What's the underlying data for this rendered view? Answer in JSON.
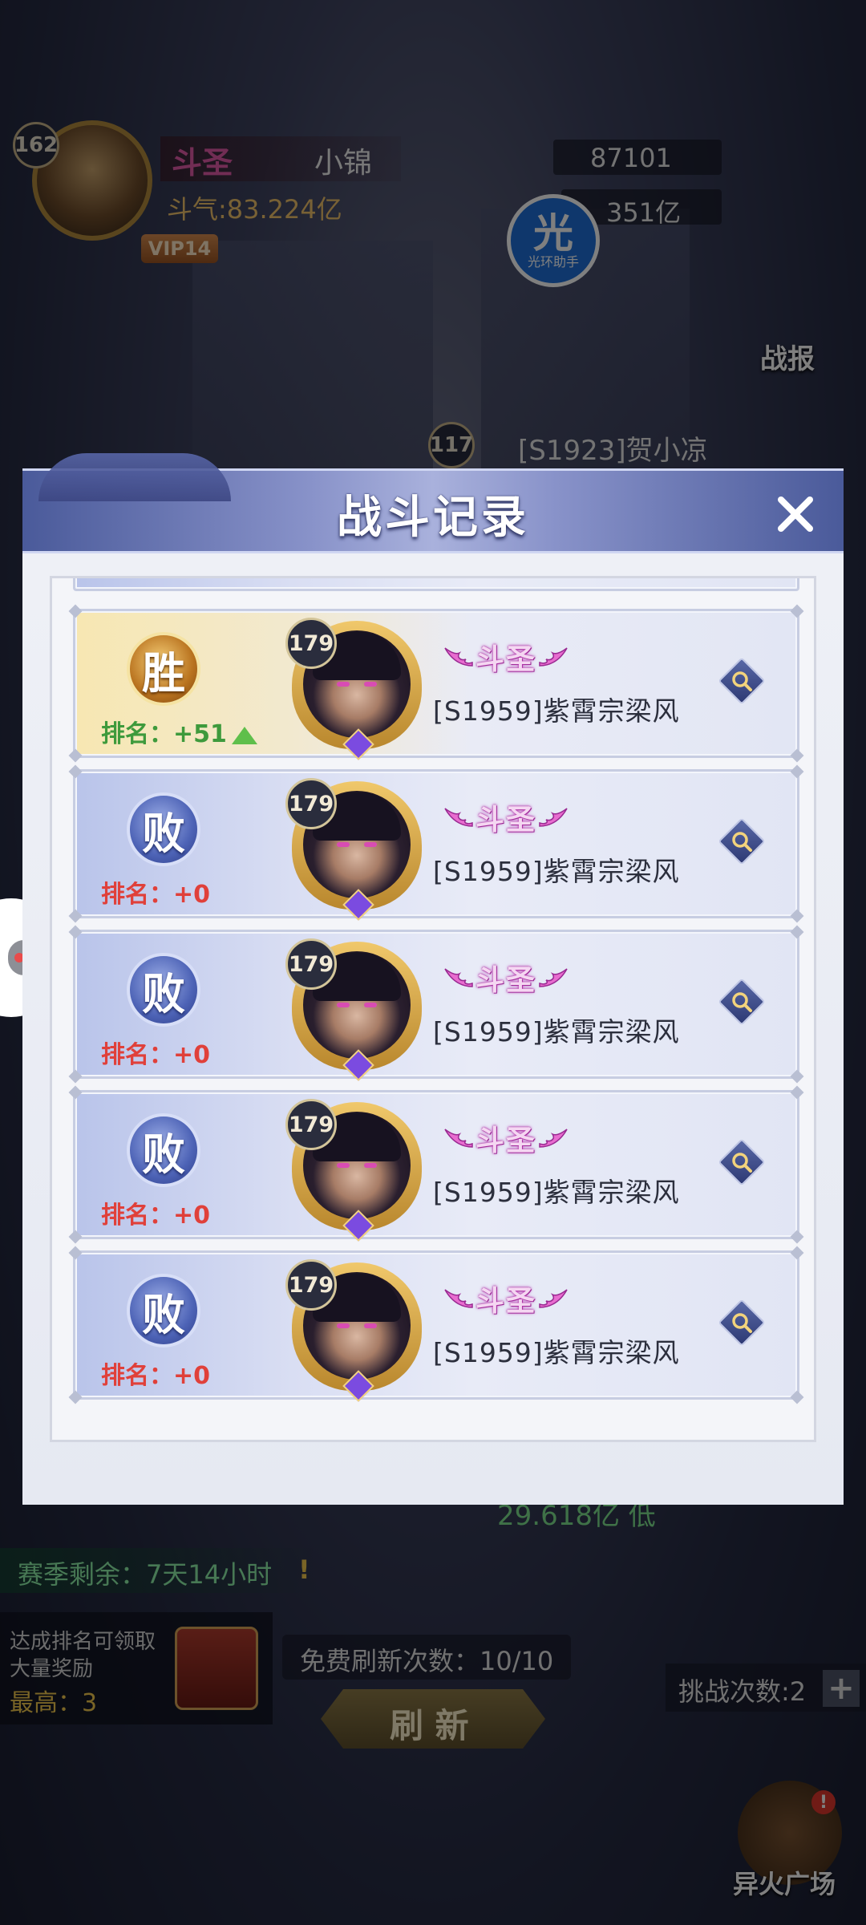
{
  "background": {
    "player": {
      "level": "162",
      "title": "斗圣",
      "name": "小锦",
      "power_label": "斗气:83.224亿",
      "vip": "VIP14"
    },
    "opponent": {
      "power": "87101",
      "power2": "351亿",
      "name": "[S1923]贺小凉",
      "level": "117"
    },
    "helper": {
      "big": "光",
      "small": "光环助手"
    },
    "battle_report_label": "战报",
    "season_remaining": "赛季剩余：7天14小时",
    "reward_text_1": "达成排名可领取",
    "reward_text_2": "大量奖励",
    "reward_best": "最高：3",
    "free_refresh": "免费刷新次数：10/10",
    "refresh_button": "刷 新",
    "challenge_count": "挑战次数:2",
    "plus": "+",
    "enemy_power_low": "29.618亿 低",
    "square_label": "异火广场",
    "notice": "!"
  },
  "modal": {
    "title": "战斗记录",
    "close_icon": "close-x-icon"
  },
  "records": [
    {
      "result": "胜",
      "type": "win",
      "rank_label": "排名：",
      "rank_change": "+51",
      "level": "179",
      "title": "斗圣",
      "name": "[S1959]紫霄宗梁风"
    },
    {
      "result": "败",
      "type": "lose",
      "rank_label": "排名：",
      "rank_change": "+0",
      "level": "179",
      "title": "斗圣",
      "name": "[S1959]紫霄宗梁风"
    },
    {
      "result": "败",
      "type": "lose",
      "rank_label": "排名：",
      "rank_change": "+0",
      "level": "179",
      "title": "斗圣",
      "name": "[S1959]紫霄宗梁风"
    },
    {
      "result": "败",
      "type": "lose",
      "rank_label": "排名：",
      "rank_change": "+0",
      "level": "179",
      "title": "斗圣",
      "name": "[S1959]紫霄宗梁风"
    },
    {
      "result": "败",
      "type": "lose",
      "rank_label": "排名：",
      "rank_change": "+0",
      "level": "179",
      "title": "斗圣",
      "name": "[S1959]紫霄宗梁风"
    }
  ],
  "colors": {
    "win_rank": "#3e9a3c",
    "lose_rank": "#e0403a",
    "header": "#8892c9"
  }
}
